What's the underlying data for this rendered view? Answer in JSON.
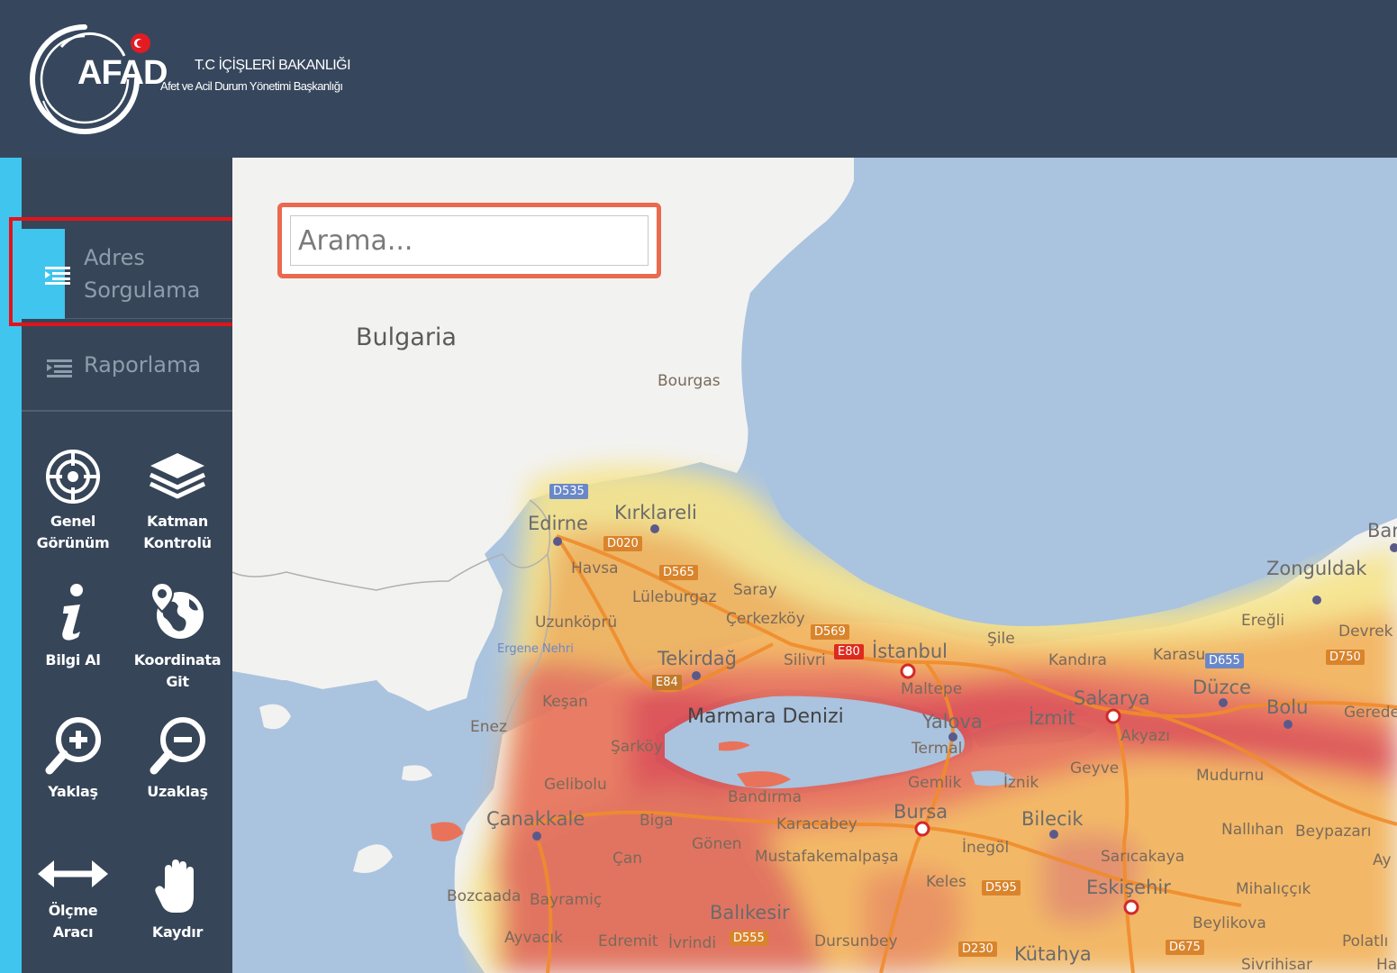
{
  "header": {
    "logo_text": "AFAD",
    "org_line1": "T.C İÇİŞLERİ BAKANLIĞI",
    "org_line2": "Afet ve Acil Durum Yönetimi Başkanlığı"
  },
  "sidebar": {
    "nav": [
      {
        "label_line1": "Adres",
        "label_line2": "Sorgulama",
        "active": true
      },
      {
        "label": "Raporlama",
        "active": false
      }
    ],
    "tools": [
      {
        "line1": "Genel",
        "line2": "Görünüm",
        "icon": "globe-target-icon"
      },
      {
        "line1": "Katman",
        "line2": "Kontrolü",
        "icon": "layers-icon"
      },
      {
        "line1": "",
        "line2": "Bilgi Al",
        "icon": "info-icon"
      },
      {
        "line1": "Koordinata",
        "line2": "Git",
        "icon": "globe-pin-icon"
      },
      {
        "line1": "",
        "line2": "Yaklaş",
        "icon": "zoom-in-icon"
      },
      {
        "line1": "",
        "line2": "Uzaklaş",
        "icon": "zoom-out-icon"
      },
      {
        "line1": "Ölçme",
        "line2": "Aracı",
        "icon": "measure-arrow-icon"
      },
      {
        "line1": "",
        "line2": "Kaydır",
        "icon": "hand-pan-icon"
      }
    ]
  },
  "search": {
    "placeholder": "Arama..."
  },
  "map": {
    "country_labels": [
      "Bulgaria"
    ],
    "sea_labels": [
      "Marmara Denizi"
    ],
    "cities": [
      "Bourgas",
      "Edirne",
      "Kırklareli",
      "Havsa",
      "Lüleburgaz",
      "Saray",
      "Uzunköprü",
      "Çerkezköy",
      "Tekirdağ",
      "Silivri",
      "İstanbul",
      "Şile",
      "Kandıra",
      "Karasu",
      "Ereğli",
      "Zonguldak",
      "Devrek",
      "Keşan",
      "Enez",
      "Şarköy",
      "Maltepe",
      "Yalova",
      "İzmit",
      "Sakarya",
      "Düzce",
      "Bolu",
      "Gerede",
      "Akyazı",
      "Termal",
      "Gemlik",
      "İznik",
      "Geyve",
      "Mudurnu",
      "Gelibolu",
      "Çanakkale",
      "Biga",
      "Bandırma",
      "Karacabey",
      "Bursa",
      "Bilecik",
      "Nallıhan",
      "Beypazarı",
      "Gönen",
      "Çan",
      "Mustafakemalpaşa",
      "İnegöl",
      "Sarıcakaya",
      "Bozcaada",
      "Bayramiç",
      "Keles",
      "Eskişehir",
      "Mihalıççık",
      "Balıkesir",
      "Beylikova",
      "Ayvacık",
      "Edremit",
      "İvrindi",
      "Dursunbey",
      "Kütahya",
      "Polatlı",
      "Sivrihisar",
      "Ergene Nehri",
      "Bar",
      "Ay",
      "Ha"
    ],
    "road_shields": [
      "D535",
      "D020",
      "D565",
      "D569",
      "E80",
      "E84",
      "D655",
      "D750",
      "D595",
      "D555",
      "D230",
      "D675"
    ]
  },
  "colors": {
    "header_bg": "#36475d",
    "sidebar_bg": "#364558",
    "accent": "#3fc5ee",
    "highlight_red": "#e2141b",
    "search_border": "#ea6a4f",
    "sea": "#aac3df",
    "land": "#f2f2f1"
  }
}
